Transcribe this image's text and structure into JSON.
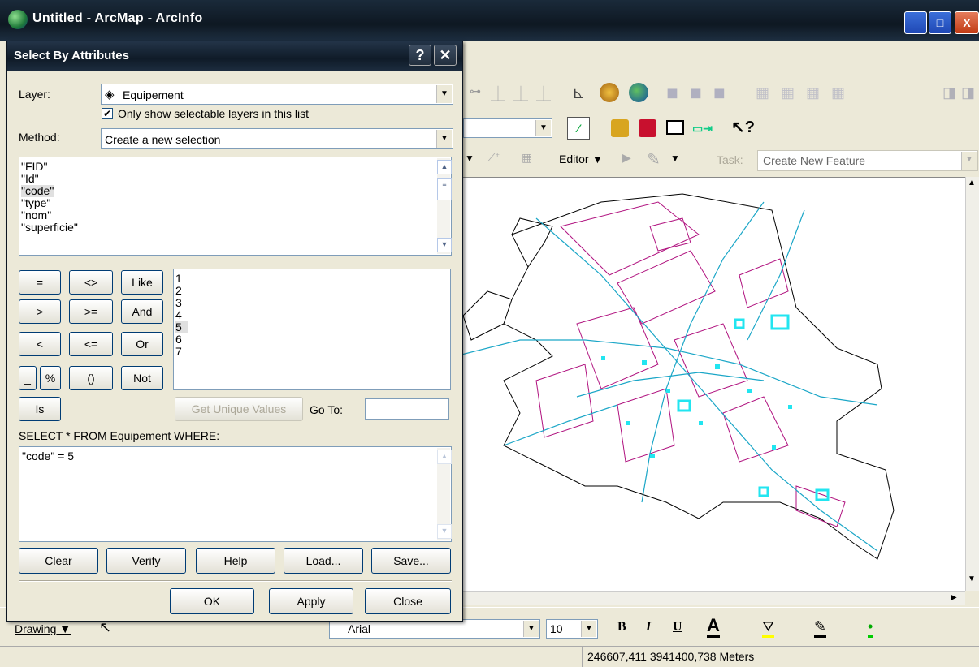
{
  "window": {
    "title": "Untitled - ArcMap - ArcInfo",
    "minimize_glyph": "_",
    "maximize_glyph": "□",
    "close_glyph": "X"
  },
  "toolbar": {
    "editor_label": "Editor",
    "task_label": "Task:",
    "task_value": "Create New Feature"
  },
  "drawing": {
    "label": "Drawing",
    "font_name": "Arial",
    "font_size": "10",
    "bold": "B",
    "italic": "I",
    "underline": "U",
    "font_color": "A"
  },
  "status": {
    "coordinates": "246607,411  3941400,738 Meters"
  },
  "dialog": {
    "title": "Select By Attributes",
    "help_glyph": "?",
    "close_glyph": "✕",
    "layer_label": "Layer:",
    "layer_value": "Equipement",
    "only_selectable": "Only show selectable layers in this list",
    "method_label": "Method:",
    "method_value": "Create a new selection",
    "fields": [
      "\"FID\"",
      "\"Id\"",
      "\"code\"",
      "\"type\"",
      "\"nom\"",
      "\"superficie\""
    ],
    "operators": {
      "eq": "=",
      "ne": "<>",
      "like": "Like",
      "gt": ">",
      "ge": ">=",
      "and": "And",
      "lt": "<",
      "le": "<=",
      "or": "Or",
      "underscore": "_",
      "percent": "%",
      "parens": "()",
      "not": "Not",
      "is": "Is"
    },
    "values": [
      "1",
      "2",
      "3",
      "4",
      "5",
      "6",
      "7"
    ],
    "get_unique": "Get Unique Values",
    "goto_label": "Go To:",
    "goto_value": "",
    "select_prefix": "SELECT * FROM Equipement WHERE:",
    "expression": "\"code\" = 5",
    "buttons": {
      "clear": "Clear",
      "verify": "Verify",
      "help": "Help",
      "load": "Load...",
      "save": "Save...",
      "ok": "OK",
      "apply": "Apply",
      "close": "Close"
    }
  },
  "colors": {
    "parcels": "#b0127f",
    "network": "#1aa6c7",
    "highlight": "#22e5f0",
    "boundary": "#000000"
  }
}
